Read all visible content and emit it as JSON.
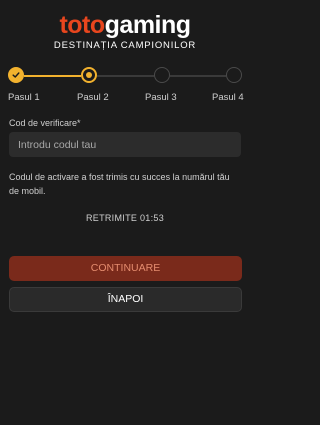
{
  "brand": {
    "logo_part1": "toto",
    "logo_part2": "gaming",
    "tagline": "DESTINAȚIA CAMPIONILOR",
    "accent_color": "#e8461e",
    "step_color": "#f2b22e"
  },
  "stepper": {
    "steps": [
      {
        "label": "Pasul 1",
        "state": "done"
      },
      {
        "label": "Pasul 2",
        "state": "current"
      },
      {
        "label": "Pasul 3",
        "state": "todo"
      },
      {
        "label": "Pasul 4",
        "state": "todo"
      }
    ]
  },
  "form": {
    "code_label": "Cod de verificare*",
    "code_placeholder": "Introdu codul tau",
    "code_value": ""
  },
  "info_text": "Codul de activare a fost trimis cu succes la numărul tău de mobil.",
  "resend_text": "RETRIMITE 01:53",
  "buttons": {
    "continue_label": "CONTINUARE",
    "back_label": "ÎNAPOI"
  }
}
